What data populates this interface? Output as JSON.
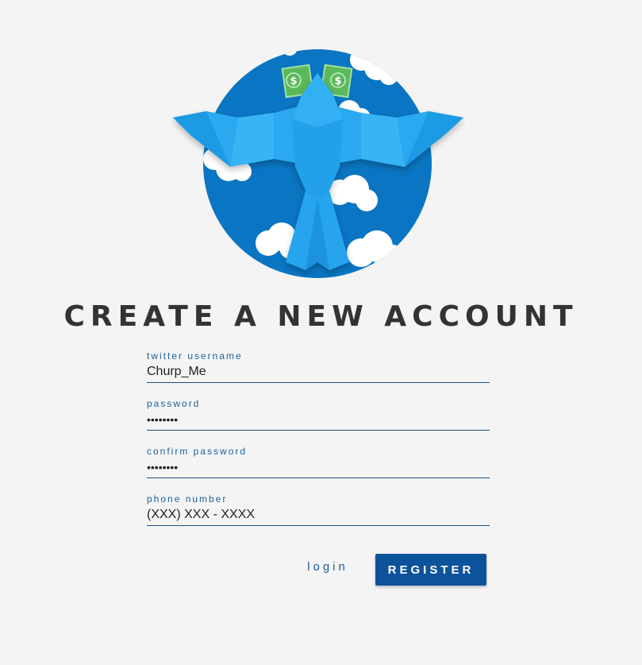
{
  "logo": {
    "name": "churp bird logo",
    "icon": "bird-with-money-logo"
  },
  "title": "CREATE A NEW ACCOUNT",
  "form": {
    "fields": [
      {
        "label": "twitter username",
        "value": "Churp_Me",
        "type": "text"
      },
      {
        "label": "password",
        "value": "••••••••",
        "type": "password"
      },
      {
        "label": "confirm password",
        "value": "••••••••",
        "type": "password"
      },
      {
        "label": "phone number",
        "value": "(XXX) XXX - XXXX",
        "type": "text"
      }
    ]
  },
  "actions": {
    "login_label": "login",
    "register_label": "REGISTER"
  },
  "colors": {
    "background": "#f4f4f4",
    "accent": "#0d539b",
    "label": "#1d5f99",
    "logo_circle": "#0a75c2",
    "bird": "#2aa8f0",
    "money": "#4caf50"
  }
}
